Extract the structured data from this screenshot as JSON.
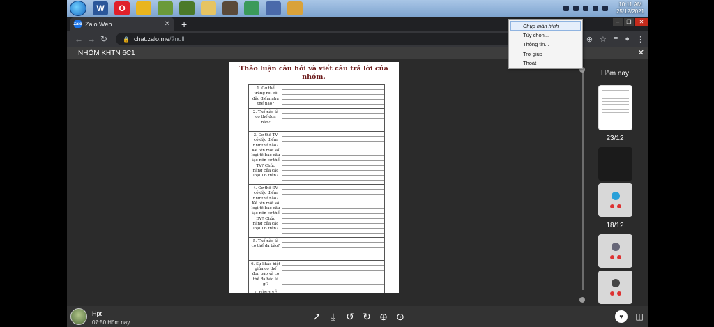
{
  "taskbar": {
    "apps": [
      {
        "name": "word-app-icon",
        "label": "W",
        "color": "#2b579a"
      },
      {
        "name": "opera-app-icon",
        "label": "O",
        "color": "#e0202b"
      },
      {
        "name": "chrome-app-icon",
        "label": "",
        "color": "#e9b51f"
      },
      {
        "name": "game-app-icon",
        "label": "",
        "color": "#6b9a3a"
      },
      {
        "name": "minecraft-app-icon",
        "label": "",
        "color": "#4b7a2a"
      },
      {
        "name": "folder-app-icon",
        "label": "",
        "color": "#e6c463"
      },
      {
        "name": "game2-app-icon",
        "label": "",
        "color": "#5a4a3a"
      },
      {
        "name": "chrome2-app-icon",
        "label": "",
        "color": "#3b9a5a"
      },
      {
        "name": "computer-app-icon",
        "label": "",
        "color": "#4a6aaa"
      },
      {
        "name": "game3-app-icon",
        "label": "",
        "color": "#d9a23a"
      }
    ],
    "clock_time": "10:11 AM",
    "clock_date": "25/12/2021"
  },
  "browser": {
    "tab_title": "Zalo Web",
    "tab_favicon": "Zalo",
    "url_host": "chat.zalo.me",
    "url_path": "/?null"
  },
  "viewer": {
    "conversation_title": "NHÓM KHTN 6C1"
  },
  "document": {
    "title": "Thảo luận câu hỏi và viết câu trả lời của nhóm.",
    "questions": [
      {
        "text": "1. Cơ thể trùng roi có đặc điểm như thế nào?",
        "lines": 4
      },
      {
        "text": "2. Thế nào là cơ thể đơn bào?",
        "lines": 4
      },
      {
        "text": "3. Cơ thể TV có đặc điểm như thế nào? Kể tên một số loại tế bào cấu tạo nên cơ thể TV? Chức năng của các loại TB trên?",
        "lines": 10
      },
      {
        "text": "4. Cơ thể ĐV có đặc điểm như thế nào? Kể tên một số loại tế bào cấu tạo nên cơ thể ĐV? Chức năng của các loại TB trên?",
        "lines": 10
      },
      {
        "text": "5. Thế nào là cơ thể đa bào?",
        "lines": 4
      },
      {
        "text": "6. Sự khác biệt giữa cơ thể đơn bào và cơ thể đa bào là gì?",
        "lines": 5
      },
      {
        "text": "7. HÌNH VẼ",
        "lines": 3
      }
    ]
  },
  "thumbnails": {
    "label_today": "Hôm nay",
    "label_day1": "23/12",
    "label_day2": "18/12"
  },
  "context_menu": {
    "items": [
      "Chụp màn hình",
      "Tùy chọn...",
      "Thông tin...",
      "Trợ giúp",
      "Thoát"
    ]
  },
  "bottom": {
    "sender_name": "Hpt",
    "sent_time": "07:50 Hôm nay"
  }
}
